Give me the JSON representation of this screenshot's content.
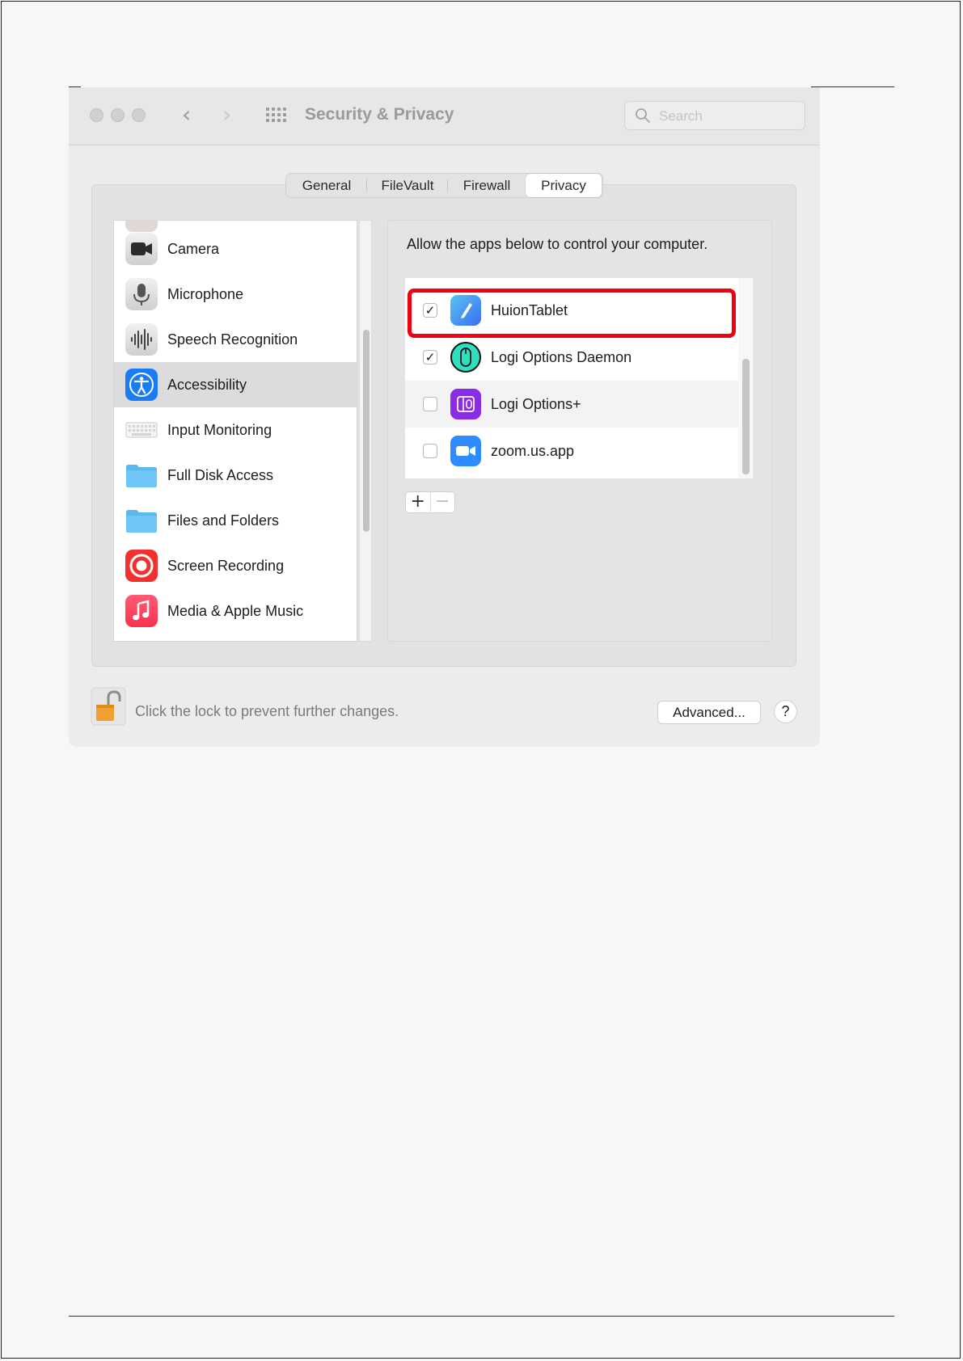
{
  "window": {
    "title": "Security & Privacy",
    "search_placeholder": "Search"
  },
  "tabs": [
    {
      "label": "General",
      "active": false
    },
    {
      "label": "FileVault",
      "active": false
    },
    {
      "label": "Firewall",
      "active": false
    },
    {
      "label": "Privacy",
      "active": true
    }
  ],
  "categories": [
    {
      "label": "Camera",
      "icon": "camera-icon"
    },
    {
      "label": "Microphone",
      "icon": "microphone-icon"
    },
    {
      "label": "Speech Recognition",
      "icon": "speech-recognition-icon"
    },
    {
      "label": "Accessibility",
      "icon": "accessibility-icon",
      "selected": true
    },
    {
      "label": "Input Monitoring",
      "icon": "keyboard-icon"
    },
    {
      "label": "Full Disk Access",
      "icon": "folder-icon"
    },
    {
      "label": "Files and Folders",
      "icon": "folder-icon"
    },
    {
      "label": "Screen Recording",
      "icon": "screen-recording-icon"
    },
    {
      "label": "Media & Apple Music",
      "icon": "music-icon"
    }
  ],
  "main": {
    "allow_text": "Allow the apps below to control your computer.",
    "apps": [
      {
        "label": "HuionTablet",
        "checked": true,
        "icon": "huion-tablet-icon"
      },
      {
        "label": "Logi Options Daemon",
        "checked": true,
        "icon": "logi-options-daemon-icon"
      },
      {
        "label": "Logi Options+",
        "checked": false,
        "icon": "logi-options-plus-icon"
      },
      {
        "label": "zoom.us.app",
        "checked": false,
        "icon": "zoom-icon"
      }
    ],
    "add_label": "+",
    "remove_label": "−"
  },
  "footer": {
    "lock_text": "Click the lock to prevent further changes.",
    "advanced_label": "Advanced...",
    "help_label": "?"
  },
  "colors": {
    "highlight": "#f00010",
    "accessibility_blue": "#1a7cf5",
    "zoom_blue": "#2d8cff"
  }
}
